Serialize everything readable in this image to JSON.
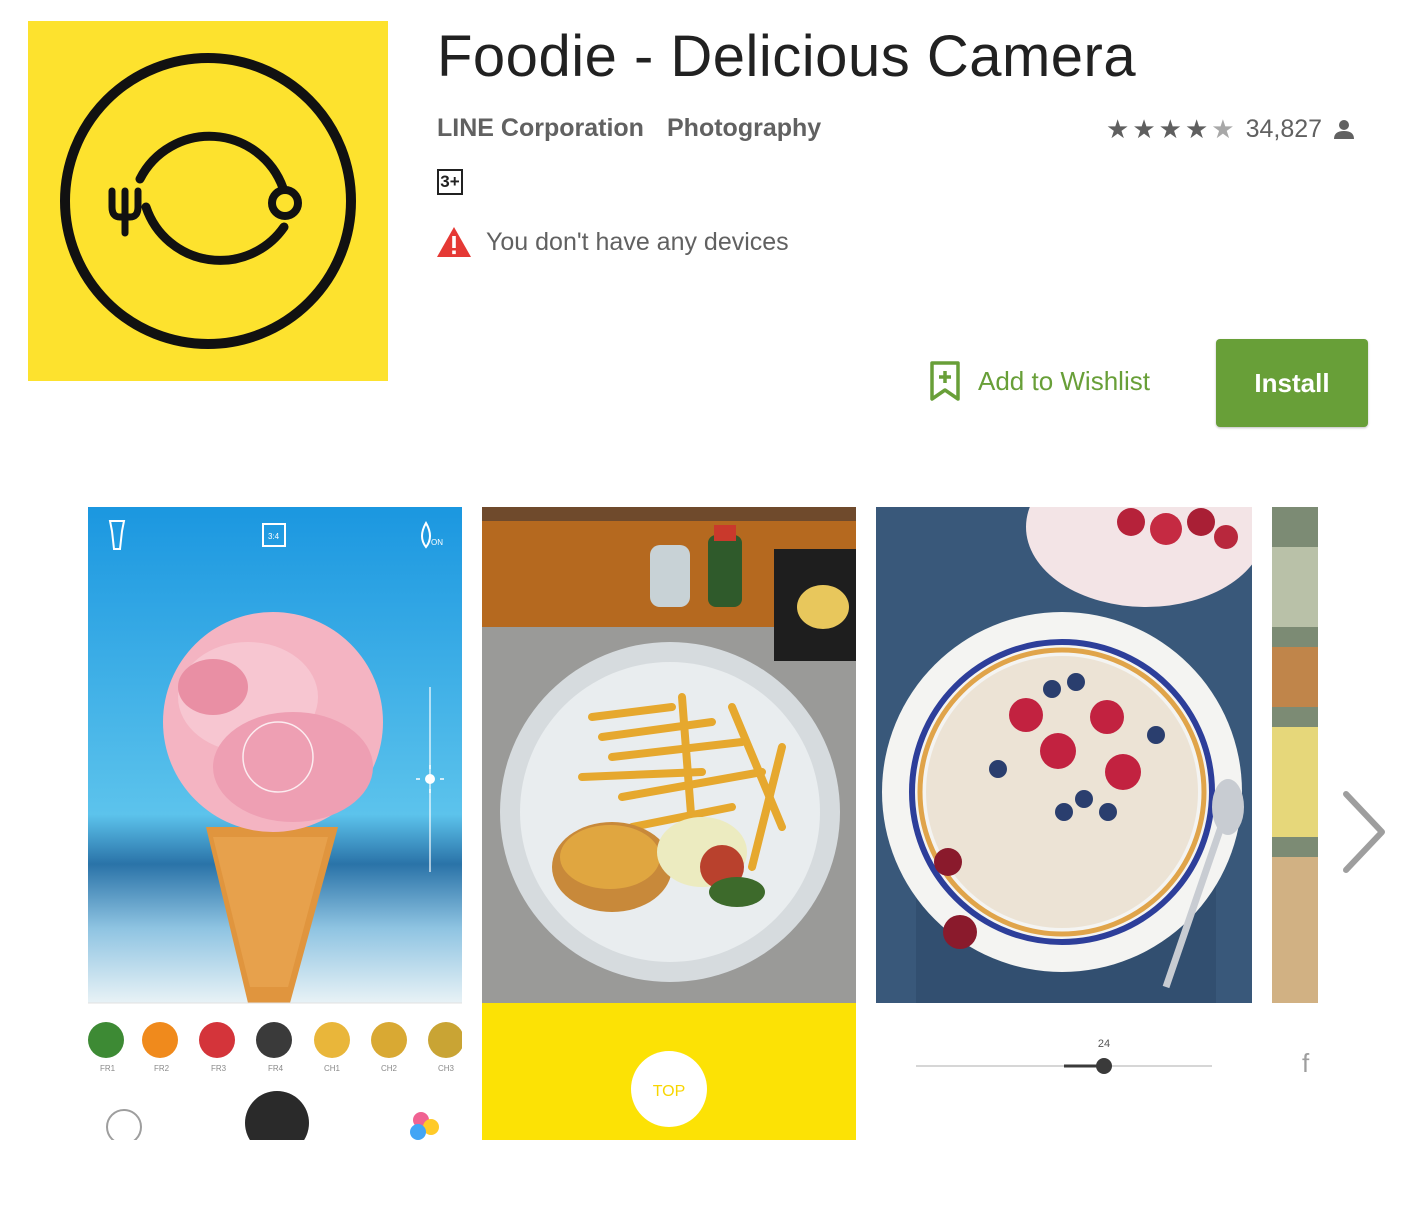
{
  "app": {
    "title": "Foodie - Delicious Camera",
    "developer": "LINE Corporation",
    "category": "Photography",
    "content_rating": "3+",
    "rating_stars": 4.5,
    "rating_count": "34,827",
    "warning_text": "You don't have any devices",
    "wishlist_label": "Add to Wishlist",
    "install_label": "Install",
    "icon_colors": {
      "background": "#FDE22E",
      "stroke": "#111111"
    }
  },
  "colors": {
    "accent_green": "#689F38",
    "warning_red": "#E53935",
    "secondary_text": "#616161"
  },
  "screenshots": {
    "shot1": {
      "filters": [
        "FR1",
        "FR2",
        "FR3",
        "FR4",
        "CH1",
        "CH2",
        "CH3"
      ],
      "icons": [
        "flashlight-icon",
        "ratio-icon",
        "droplet-on-icon",
        "brightness-slider-icon"
      ]
    },
    "shot2": {
      "top_label": "TOP"
    },
    "shot3": {
      "slider_value": "24"
    }
  },
  "carousel": {
    "next_icon": "chevron-right-icon"
  }
}
